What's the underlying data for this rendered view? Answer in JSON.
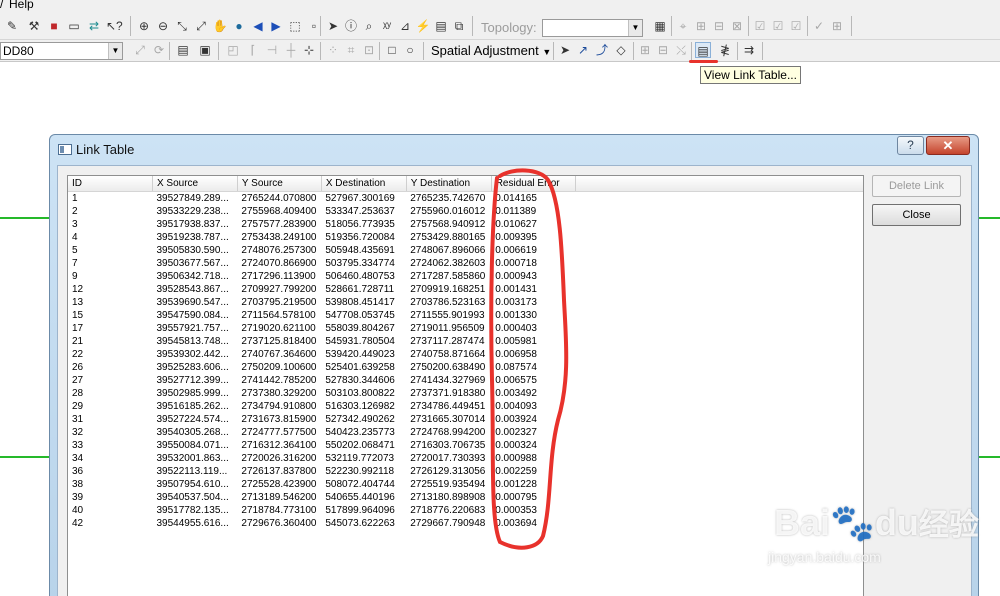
{
  "menubar": {
    "help_label": "Help"
  },
  "toolbar_top": {
    "topology_label": "Topology:",
    "topology_value": ""
  },
  "toolbar_bottom": {
    "layer_value": "DD80",
    "spatial_adjustment_label": "Spatial Adjustment"
  },
  "tooltip": {
    "text": "View Link Table..."
  },
  "dialog": {
    "title": "Link Table",
    "help_label": "?",
    "close_glyph": "✕",
    "delete_link_label": "Delete Link",
    "close_label": "Close",
    "columns": [
      "ID",
      "X Source",
      "Y Source",
      "X Destination",
      "Y Destination",
      "Residual Error"
    ],
    "rows": [
      [
        "1",
        "39527849.289...",
        "2765244.070800",
        "527967.300169",
        "2765235.742670",
        "0.014165"
      ],
      [
        "2",
        "39533229.238...",
        "2755968.409400",
        "533347.253637",
        "2755960.016012",
        "0.011389"
      ],
      [
        "3",
        "39517938.837...",
        "2757577.283900",
        "518056.773935",
        "2757568.940912",
        "0.010627"
      ],
      [
        "4",
        "39519238.787...",
        "2753438.249100",
        "519356.720084",
        "2753429.880165",
        "0.009395"
      ],
      [
        "5",
        "39505830.590...",
        "2748076.257300",
        "505948.435691",
        "2748067.896066",
        "0.006619"
      ],
      [
        "7",
        "39503677.567...",
        "2724070.866900",
        "503795.334774",
        "2724062.382603",
        "0.000718"
      ],
      [
        "9",
        "39506342.718...",
        "2717296.113900",
        "506460.480753",
        "2717287.585860",
        "0.000943"
      ],
      [
        "12",
        "39528543.867...",
        "2709927.799200",
        "528661.728711",
        "2709919.168251",
        "0.001431"
      ],
      [
        "13",
        "39539690.547...",
        "2703795.219500",
        "539808.451417",
        "2703786.523163",
        "0.003173"
      ],
      [
        "15",
        "39547590.084...",
        "2711564.578100",
        "547708.053745",
        "2711555.901993",
        "0.001330"
      ],
      [
        "17",
        "39557921.757...",
        "2719020.621100",
        "558039.804267",
        "2719011.956509",
        "0.000403"
      ],
      [
        "21",
        "39545813.748...",
        "2737125.818400",
        "545931.780504",
        "2737117.287474",
        "0.005981"
      ],
      [
        "22",
        "39539302.442...",
        "2740767.364600",
        "539420.449023",
        "2740758.871664",
        "0.006958"
      ],
      [
        "26",
        "39525283.606...",
        "2750209.100600",
        "525401.639258",
        "2750200.638490",
        "0.087574"
      ],
      [
        "27",
        "39527712.399...",
        "2741442.785200",
        "527830.344606",
        "2741434.327969",
        "0.006575"
      ],
      [
        "28",
        "39502985.999...",
        "2737380.329200",
        "503103.800822",
        "2737371.918380",
        "0.003492"
      ],
      [
        "29",
        "39516185.262...",
        "2734794.910800",
        "516303.126982",
        "2734786.449451",
        "0.004093"
      ],
      [
        "31",
        "39527224.574...",
        "2731673.815900",
        "527342.490262",
        "2731665.307014",
        "0.003924"
      ],
      [
        "32",
        "39540305.268...",
        "2724777.577500",
        "540423.235773",
        "2724768.994200",
        "0.002327"
      ],
      [
        "33",
        "39550084.071...",
        "2716312.364100",
        "550202.068471",
        "2716303.706735",
        "0.000324"
      ],
      [
        "34",
        "39532001.863...",
        "2720026.316200",
        "532119.772073",
        "2720017.730393",
        "0.000988"
      ],
      [
        "36",
        "39522113.119...",
        "2726137.837800",
        "522230.992118",
        "2726129.313056",
        "0.002259"
      ],
      [
        "38",
        "39507954.610...",
        "2725528.423900",
        "508072.404744",
        "2725519.935494",
        "0.001228"
      ],
      [
        "39",
        "39540537.504...",
        "2713189.546200",
        "540655.440196",
        "2713180.898908",
        "0.000795"
      ],
      [
        "40",
        "39517782.135...",
        "2718784.773100",
        "517899.964096",
        "2718776.220683",
        "0.000353"
      ],
      [
        "42",
        "39544955.616...",
        "2729676.360400",
        "545073.622263",
        "2729667.790948",
        "0.003694"
      ]
    ]
  },
  "watermark": {
    "brand_1": "Bai",
    "brand_2": "du",
    "brand_cn": "经验",
    "url": "jingyan.baidu.com"
  },
  "colors": {
    "annotation_red": "#e8322c",
    "green_line": "#25b92a",
    "title_bar": "#c3dbef"
  }
}
